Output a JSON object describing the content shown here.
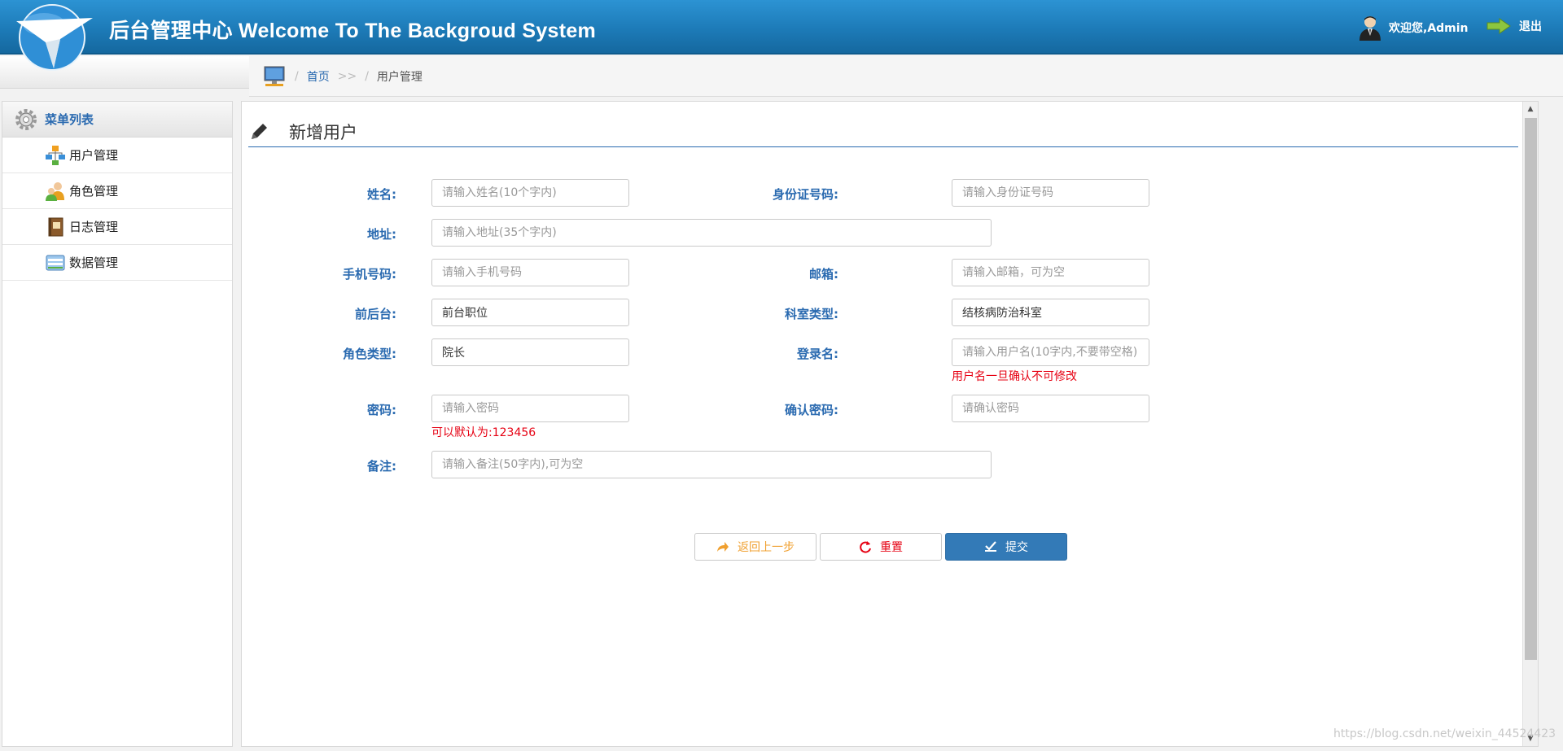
{
  "header": {
    "title": "后台管理中心 Welcome To The Backgroud System",
    "welcome_text": "欢迎您,Admin",
    "logout_label": "退出",
    "colors": {
      "header_top": "#2c93d3",
      "header_bottom": "#15689f"
    }
  },
  "breadcrumb": {
    "home_label": "首页",
    "arrow": ">>",
    "current_label": "用户管理",
    "separator": "/"
  },
  "sidebar": {
    "title": "菜单列表",
    "items": [
      {
        "label": "用户管理",
        "icon": "user-manage-icon"
      },
      {
        "label": "角色管理",
        "icon": "role-manage-icon"
      },
      {
        "label": "日志管理",
        "icon": "log-book-icon"
      },
      {
        "label": "数据管理",
        "icon": "data-manage-icon"
      }
    ]
  },
  "form": {
    "title": "新增用户",
    "name": {
      "label": "姓名:",
      "value": "",
      "placeholder": "请输入姓名(10个字内)"
    },
    "id_card": {
      "label": "身份证号码:",
      "value": "",
      "placeholder": "请输入身份证号码"
    },
    "address": {
      "label": "地址:",
      "value": "",
      "placeholder": "请输入地址(35个字内)"
    },
    "phone": {
      "label": "手机号码:",
      "value": "",
      "placeholder": "请输入手机号码"
    },
    "email": {
      "label": "邮箱:",
      "value": "",
      "placeholder": "请输入邮箱，可为空"
    },
    "front_back": {
      "label": "前后台:",
      "value": "前台职位"
    },
    "department": {
      "label": "科室类型:",
      "value": "结核病防治科室"
    },
    "role": {
      "label": "角色类型:",
      "value": "院长"
    },
    "login_name": {
      "label": "登录名:",
      "value": "",
      "placeholder": "请输入用户名(10字内,不要带空格)",
      "hint": "用户名一旦确认不可修改"
    },
    "password": {
      "label": "密码:",
      "value": "",
      "placeholder": "请输入密码",
      "hint": "可以默认为:123456"
    },
    "confirm_password": {
      "label": "确认密码:",
      "value": "",
      "placeholder": "请确认密码"
    },
    "remark": {
      "label": "备注:",
      "value": "",
      "placeholder": "请输入备注(50字内),可为空"
    }
  },
  "buttons": {
    "back_label": "返回上一步",
    "reset_label": "重置",
    "submit_label": "提交",
    "colors": {
      "back": "#f0a030",
      "reset": "#e60012",
      "submit": "#337ab7"
    }
  },
  "watermark": "https://blog.csdn.net/weixin_44524423",
  "colors": {
    "accent": "#2a6ab0",
    "hint_red": "#e60012"
  }
}
